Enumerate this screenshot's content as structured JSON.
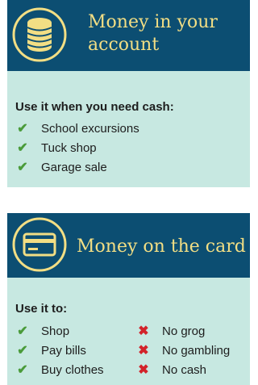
{
  "panels": [
    {
      "icon": "coin-stack-icon",
      "title": "Money in your\naccount",
      "lead": "Use it when you need cash:",
      "items": [
        "School excursions",
        "Tuck shop",
        "Garage sale"
      ]
    },
    {
      "icon": "card-icon",
      "title": "Money on the card",
      "lead": "Use it to:",
      "items_yes": [
        "Shop",
        "Pay bills",
        "Buy clothes"
      ],
      "items_no": [
        "No grog",
        "No gambling",
        "No cash"
      ]
    }
  ],
  "colors": {
    "header_bg": "#0c4e72",
    "title_text": "#f2de84",
    "body_bg": "#c7e8e1",
    "check": "#4a9b3a",
    "cross": "#d2232a"
  },
  "icons": {
    "check": "✔",
    "cross": "✖"
  }
}
